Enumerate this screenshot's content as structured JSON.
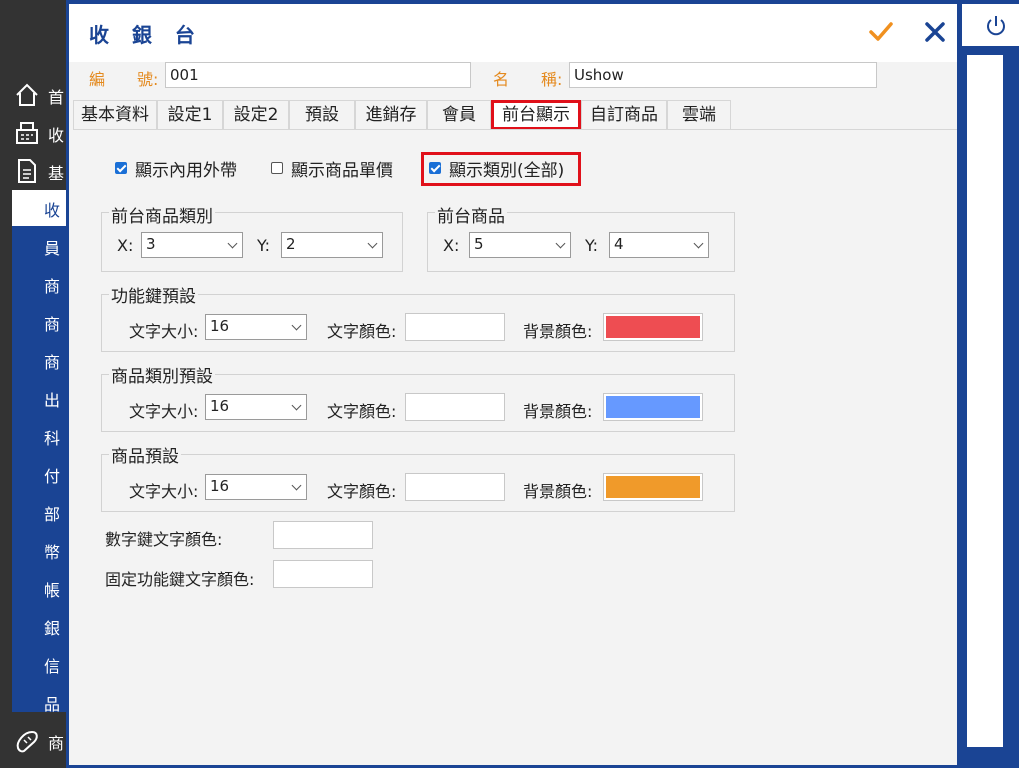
{
  "app": {
    "sidebar_top": [
      {
        "label": "首",
        "icon": "home-icon"
      },
      {
        "label": "收",
        "icon": "cash-register-icon"
      },
      {
        "label": "基",
        "icon": "document-icon"
      }
    ],
    "sidebar_items": [
      "收",
      "員",
      "商",
      "商",
      "商",
      "出",
      "科",
      "付",
      "部",
      "幣",
      "帳",
      "銀",
      "信",
      "品"
    ],
    "sidebar_bottom": {
      "label": "商",
      "icon": "bread-icon"
    },
    "power_icon": "power-icon"
  },
  "dialog": {
    "title": "收 銀 台",
    "ok_icon": "checkmark-icon",
    "close_icon": "close-icon",
    "colors": {
      "accent": "#1a4494",
      "orange": "#e48a1f",
      "ok": "#f0901f",
      "highlight": "#e0101a"
    },
    "code_label": "編　　號:",
    "code_value": "001",
    "name_label": "名　　稱:",
    "name_value": "Ushow",
    "tabs": [
      "基本資料",
      "設定1",
      "設定2",
      "預設",
      "進銷存",
      "會員",
      "前台顯示",
      "自訂商品",
      "雲端"
    ],
    "selected_tab": "前台顯示",
    "checkboxes": [
      {
        "label": "顯示內用外帶",
        "checked": true
      },
      {
        "label": "顯示商品單價",
        "checked": false
      },
      {
        "label": "顯示類別(全部)",
        "checked": true
      }
    ],
    "category_group": {
      "title": "前台商品類別",
      "x_label": "X:",
      "x_value": "3",
      "y_label": "Y:",
      "y_value": "2"
    },
    "product_group": {
      "title": "前台商品",
      "x_label": "X:",
      "x_value": "5",
      "y_label": "Y:",
      "y_value": "4"
    },
    "function_key": {
      "title": "功能鍵預設",
      "size_label": "文字大小:",
      "size_value": "16",
      "text_color_label": "文字顏色:",
      "text_color": "#ffffff",
      "bg_color_label": "背景顏色:",
      "bg_color": "#ee4d52"
    },
    "category_default": {
      "title": "商品類別預設",
      "size_label": "文字大小:",
      "size_value": "16",
      "text_color_label": "文字顏色:",
      "text_color": "#ffffff",
      "bg_color_label": "背景顏色:",
      "bg_color": "#6699ff"
    },
    "product_default": {
      "title": "商品預設",
      "size_label": "文字大小:",
      "size_value": "16",
      "text_color_label": "文字顏色:",
      "text_color": "#ffffff",
      "bg_color_label": "背景顏色:",
      "bg_color": "#f09a2a"
    },
    "numpad_color_label": "數字鍵文字顏色:",
    "fixed_key_color_label": "固定功能鍵文字顏色:"
  }
}
